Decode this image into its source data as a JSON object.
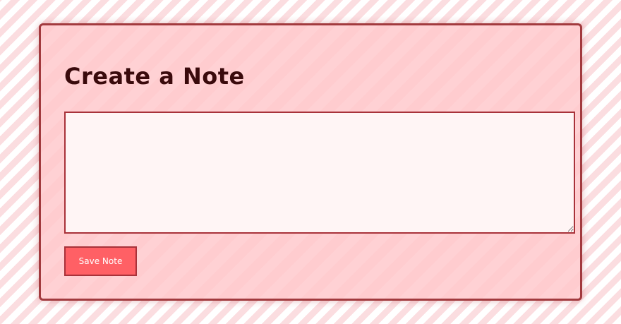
{
  "note_form": {
    "title": "Create a Note",
    "textarea": {
      "value": "",
      "placeholder": ""
    },
    "save_label": "Save Note"
  },
  "colors": {
    "card_background": "#ffcccf",
    "card_border": "#a23a3e",
    "title_text": "#3a0a0c",
    "textarea_background": "#fff5f5",
    "button_background": "#ff6065",
    "button_text": "#ffffff"
  }
}
